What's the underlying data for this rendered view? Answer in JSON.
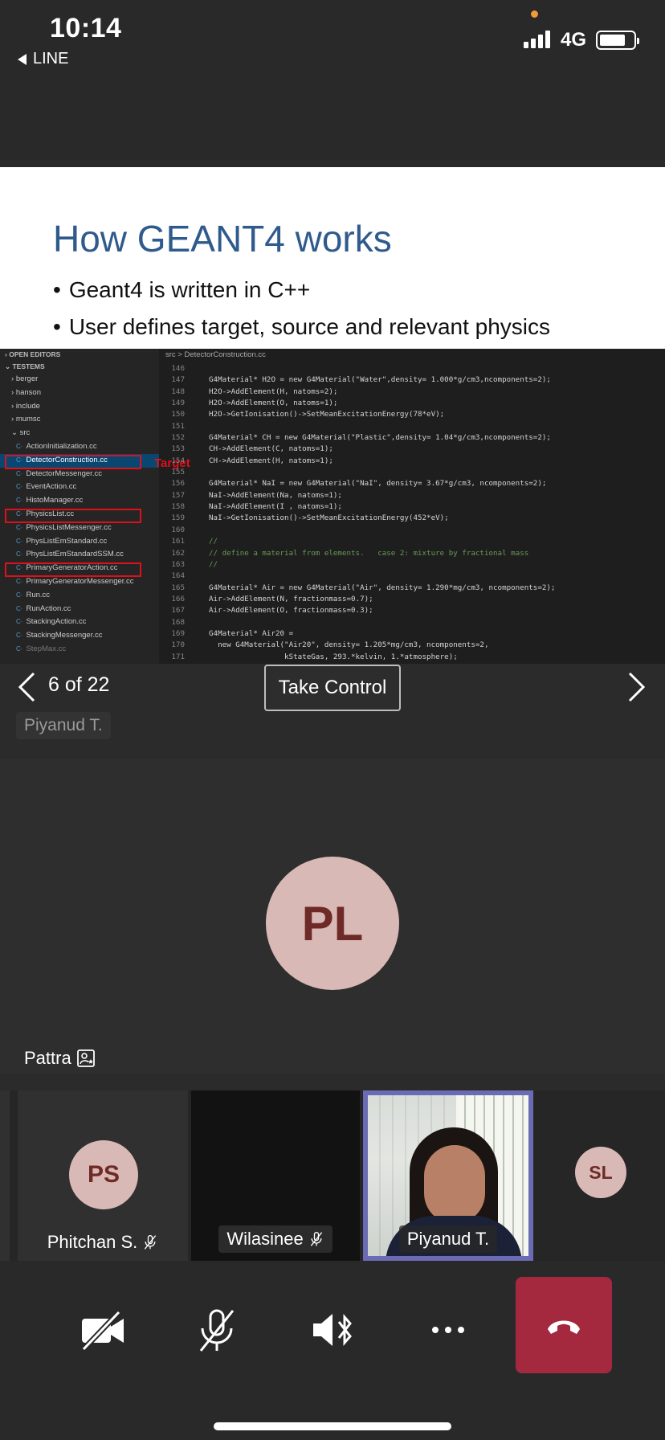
{
  "status_bar": {
    "time": "10:14",
    "back_app": "LINE",
    "network": "4G"
  },
  "slide": {
    "title": "How GEANT4 works",
    "bullets": [
      "Geant4 is written in C++",
      "User defines target, source and relevant physics"
    ]
  },
  "ide": {
    "open_editors": "OPEN EDITORS",
    "project": "TESTEMS",
    "folders": [
      "berger",
      "hanson",
      "include",
      "mumsc",
      "src"
    ],
    "files": [
      "ActionInitialization.cc",
      "DetectorConstruction.cc",
      "DetectorMessenger.cc",
      "EventAction.cc",
      "HistoManager.cc",
      "PhysicsList.cc",
      "PhysicsListMessenger.cc",
      "PhysListEmStandard.cc",
      "PhysListEmStandardSSM.cc",
      "PrimaryGeneratorAction.cc",
      "PrimaryGeneratorMessenger.cc",
      "Run.cc",
      "RunAction.cc",
      "StackingAction.cc",
      "StackingMessenger.cc",
      "StepMax.cc"
    ],
    "annotation": "Target",
    "breadcrumb": "src > DetectorConstruction.cc",
    "code": [
      {
        "n": "146",
        "t": ""
      },
      {
        "n": "147",
        "t": "G4Material* H2O = new G4Material(\"Water\",density= 1.000*g/cm3,ncomponents=2);"
      },
      {
        "n": "148",
        "t": "H2O->AddElement(H, natoms=2);"
      },
      {
        "n": "149",
        "t": "H2O->AddElement(O, natoms=1);"
      },
      {
        "n": "150",
        "t": "H2O->GetIonisation()->SetMeanExcitationEnergy(78*eV);"
      },
      {
        "n": "151",
        "t": ""
      },
      {
        "n": "152",
        "t": "G4Material* CH = new G4Material(\"Plastic\",density= 1.04*g/cm3,ncomponents=2);"
      },
      {
        "n": "153",
        "t": "CH->AddElement(C, natoms=1);"
      },
      {
        "n": "154",
        "t": "CH->AddElement(H, natoms=1);"
      },
      {
        "n": "155",
        "t": ""
      },
      {
        "n": "156",
        "t": "G4Material* NaI = new G4Material(\"NaI\", density= 3.67*g/cm3, ncomponents=2);"
      },
      {
        "n": "157",
        "t": "NaI->AddElement(Na, natoms=1);"
      },
      {
        "n": "158",
        "t": "NaI->AddElement(I , natoms=1);"
      },
      {
        "n": "159",
        "t": "NaI->GetIonisation()->SetMeanExcitationEnergy(452*eV);"
      },
      {
        "n": "160",
        "t": ""
      },
      {
        "n": "161",
        "t": "//"
      },
      {
        "n": "162",
        "t": "// define a material from elements.   case 2: mixture by fractional mass"
      },
      {
        "n": "163",
        "t": "//"
      },
      {
        "n": "164",
        "t": ""
      },
      {
        "n": "165",
        "t": "G4Material* Air = new G4Material(\"Air\", density= 1.290*mg/cm3, ncomponents=2);"
      },
      {
        "n": "166",
        "t": "Air->AddElement(N, fractionmass=0.7);"
      },
      {
        "n": "167",
        "t": "Air->AddElement(O, fractionmass=0.3);"
      },
      {
        "n": "168",
        "t": ""
      },
      {
        "n": "169",
        "t": "G4Material* Air20 ="
      },
      {
        "n": "170",
        "t": "  new G4Material(\"Air20\", density= 1.205*mg/cm3, ncomponents=2,"
      },
      {
        "n": "171",
        "t": "                 kStateGas, 293.*kelvin, 1.*atmosphere);"
      }
    ]
  },
  "share_controls": {
    "page_count": "6 of 22",
    "take_control": "Take Control",
    "presenter": "Piyanud T."
  },
  "main_participant": {
    "initials": "PL",
    "name": "Pattra"
  },
  "strip": [
    {
      "initials": "PS",
      "name": "Phitchan S."
    },
    {
      "name": "Wilasinee"
    },
    {
      "name": "Piyanud T."
    },
    {
      "initials": "SL"
    }
  ],
  "colors": {
    "avatar_bg": "#d9b9b5",
    "avatar_text": "#6e2a27",
    "hangup": "#a4293f",
    "active_speaker_border": "#6b6bb5",
    "slide_title": "#2f5b8c"
  },
  "icons": {
    "video_off": "video-off-icon",
    "mic_off": "mic-off-icon",
    "speaker": "speaker-bluetooth-icon",
    "more": "more-icon",
    "hangup": "hangup-icon"
  }
}
